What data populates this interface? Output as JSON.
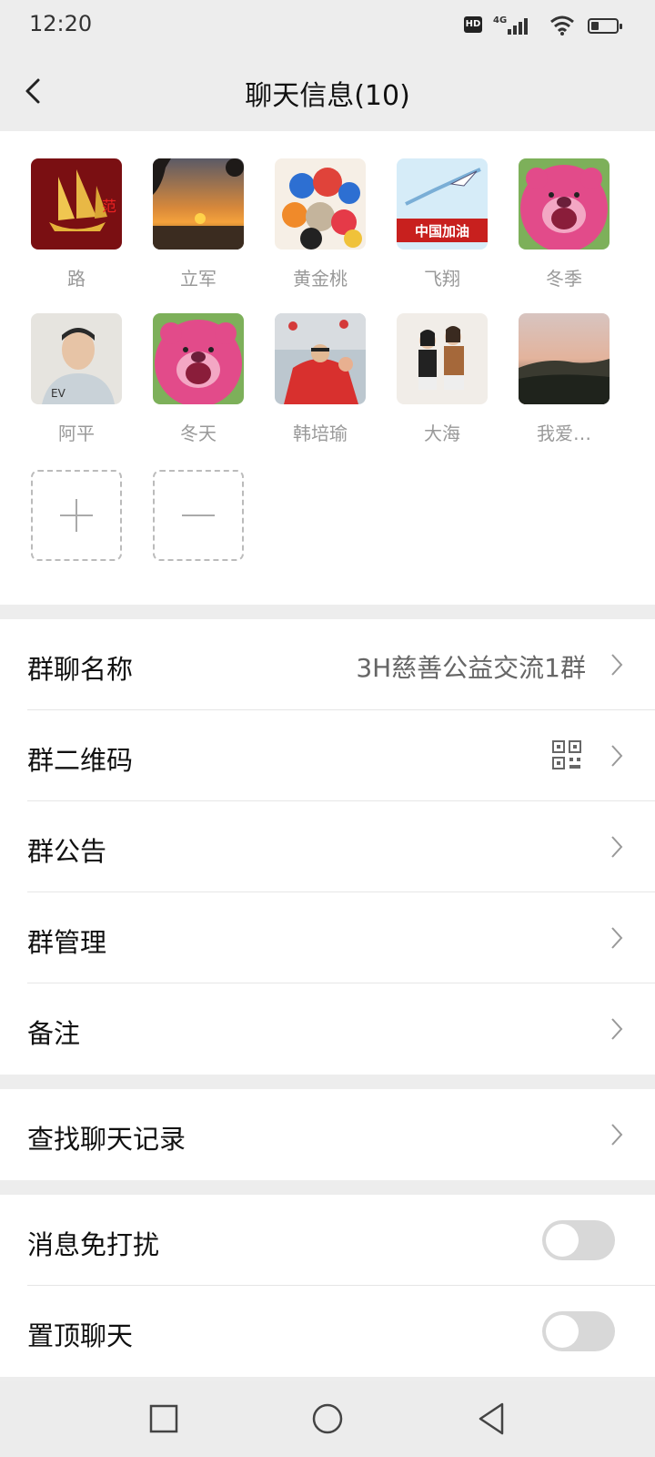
{
  "status": {
    "time": "12:20",
    "hd": "HD",
    "network": "4G",
    "battery_level": 0.3
  },
  "nav": {
    "title": "聊天信息(10)"
  },
  "members": [
    {
      "name": "路",
      "avatar": "golden-ship-avatar"
    },
    {
      "name": "立军",
      "avatar": "sunset-avatar"
    },
    {
      "name": "黄金桃",
      "avatar": "plush-toys-avatar"
    },
    {
      "name": "飞翔",
      "avatar": "jet-china-avatar",
      "badge": "中国加油"
    },
    {
      "name": "冬季",
      "avatar": "pink-bear-avatar"
    },
    {
      "name": "阿平",
      "avatar": "man-photo-avatar"
    },
    {
      "name": "冬天",
      "avatar": "pink-bear-avatar"
    },
    {
      "name": "韩培瑜",
      "avatar": "festival-photo-avatar"
    },
    {
      "name": "大海",
      "avatar": "two-girls-avatar"
    },
    {
      "name": "我爱…",
      "avatar": "mountain-dusk-avatar"
    }
  ],
  "settings": {
    "group_name_label": "群聊名称",
    "group_name_value": "3H慈善公益交流1群",
    "qr_label": "群二维码",
    "notice_label": "群公告",
    "manage_label": "群管理",
    "remark_label": "备注",
    "search_label": "查找聊天记录",
    "mute_label": "消息免打扰",
    "pin_label": "置顶聊天",
    "mute_on": false,
    "pin_on": false
  }
}
